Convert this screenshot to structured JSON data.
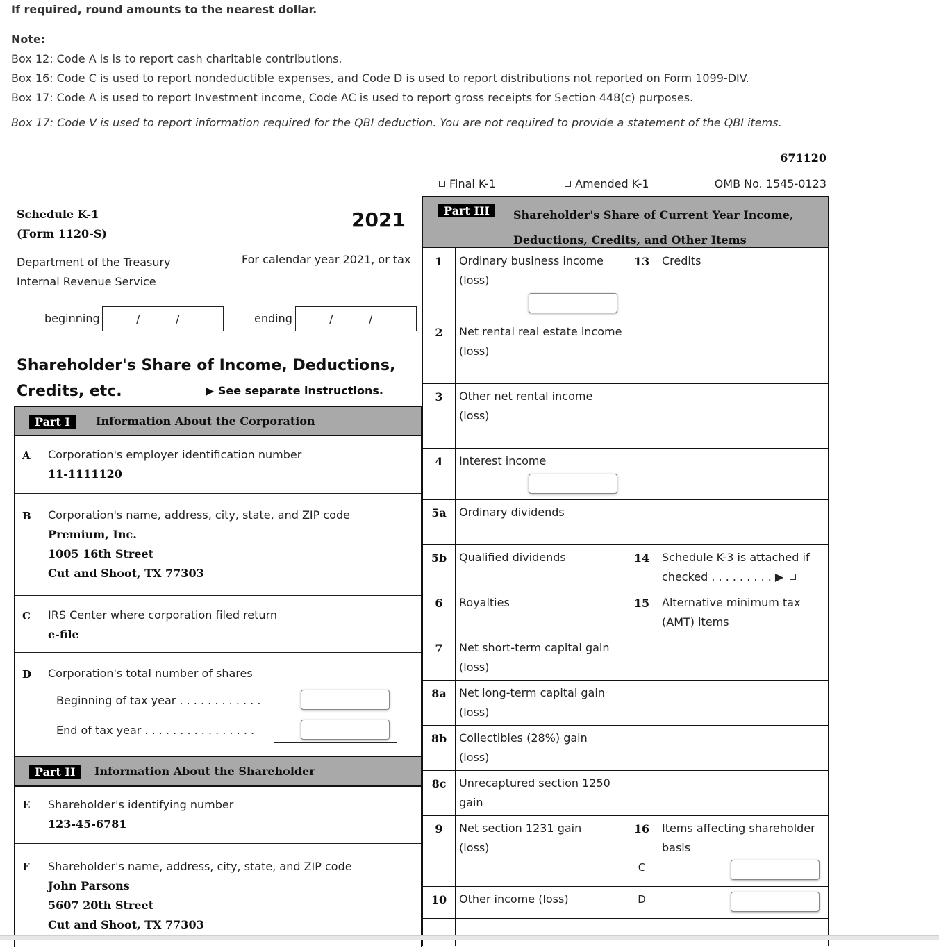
{
  "instructions": {
    "rounding": "If required, round amounts to the nearest dollar.",
    "note_label": "Note:",
    "notes": [
      "Box 12: Code A is is to report cash charitable contributions.",
      "Box 16: Code C is used to report nondeductible expenses, and Code D is used to report distributions not reported on Form 1099-DIV.",
      "Box 17: Code A is used to report Investment income, Code AC is used to report gross receipts for Section 448(c) purposes."
    ],
    "qbi_note": "Box 17: Code V is used to report information required for the QBI deduction. You are not required to provide a statement of the QBI items."
  },
  "header": {
    "form_code": "671120",
    "final_k1": "Final K-1",
    "amended_k1": "Amended K-1",
    "omb": "OMB No. 1545-0123",
    "schedule": "Schedule K-1",
    "form": "(Form 1120-S)",
    "year": "2021",
    "dept_line1": "Department of the Treasury",
    "dept_line2": "Internal Revenue Service",
    "calendar_year": "For calendar year 2021, or tax",
    "beginning_label": "beginning",
    "ending_label": "ending",
    "date_sep": "/",
    "title_line1": "Shareholder's Share of Income, Deductions,",
    "title_line2": "Credits, etc.",
    "see_instructions": "▶ See separate instructions."
  },
  "part1": {
    "label": "Part I",
    "title": "Information About the Corporation",
    "A": {
      "letter": "A",
      "label": "Corporation's employer identification number",
      "value": "11-1111120"
    },
    "B": {
      "letter": "B",
      "label": "Corporation's name, address, city, state, and ZIP code",
      "lines": [
        "Premium, Inc.",
        "1005 16th Street",
        "Cut and Shoot, TX 77303"
      ]
    },
    "C": {
      "letter": "C",
      "label": "IRS Center where corporation filed return",
      "value": "e-file"
    },
    "D": {
      "letter": "D",
      "label": "Corporation's total number of shares",
      "beginning": "Beginning of tax year . . . . . . . . . . . .",
      "end": "End of tax year . . . . . . . . . . . . . . . .",
      "beginning_value": "",
      "end_value": ""
    }
  },
  "part2": {
    "label": "Part II",
    "title": "Information About the Shareholder",
    "E": {
      "letter": "E",
      "label": "Shareholder's identifying number",
      "value": "123-45-6781"
    },
    "F": {
      "letter": "F",
      "label": "Shareholder's name, address, city, state, and ZIP code",
      "lines": [
        "John Parsons",
        "5607 20th Street",
        "Cut and Shoot, TX 77303"
      ]
    }
  },
  "part3": {
    "label": "Part III",
    "title_line1": "Shareholder's Share of Current Year Income,",
    "title_line2": "Deductions, Credits, and Other Items",
    "rows": [
      {
        "num": "1",
        "desc1": "Ordinary business income",
        "desc2": "(loss)",
        "value": ""
      },
      {
        "num": "2",
        "desc1": "Net rental real estate income",
        "desc2": "(loss)"
      },
      {
        "num": "3",
        "desc1": "Other net rental income",
        "desc2": "(loss)"
      },
      {
        "num": "4",
        "desc1": "Interest income",
        "desc2": "",
        "value": ""
      },
      {
        "num": "5a",
        "desc1": "Ordinary dividends",
        "desc2": ""
      },
      {
        "num": "5b",
        "desc1": "Qualified dividends",
        "desc2": ""
      },
      {
        "num": "6",
        "desc1": "Royalties",
        "desc2": ""
      },
      {
        "num": "7",
        "desc1": "Net short-term capital gain",
        "desc2": "(loss)"
      },
      {
        "num": "8a",
        "desc1": "Net long-term capital gain",
        "desc2": "(loss)"
      },
      {
        "num": "8b",
        "desc1": "Collectibles (28%) gain",
        "desc2": "(loss)"
      },
      {
        "num": "8c",
        "desc1": "Unrecaptured section 1250",
        "desc2": "gain"
      },
      {
        "num": "9",
        "desc1": "Net section 1231 gain",
        "desc2": "(loss)"
      },
      {
        "num": "10",
        "desc1": "Other income (loss)",
        "desc2": ""
      }
    ],
    "right": {
      "13": {
        "num": "13",
        "desc1": "Credits"
      },
      "14": {
        "num": "14",
        "desc1": "Schedule K-3 is attached if",
        "desc2": "checked . . . . . . . . . ▶"
      },
      "15": {
        "num": "15",
        "desc1": "Alternative minimum tax",
        "desc2": "(AMT) items"
      },
      "16": {
        "num": "16",
        "desc1": "Items affecting shareholder",
        "desc2": "basis",
        "codes": [
          {
            "code": "C",
            "value": ""
          },
          {
            "code": "D",
            "value": ""
          }
        ]
      }
    }
  }
}
